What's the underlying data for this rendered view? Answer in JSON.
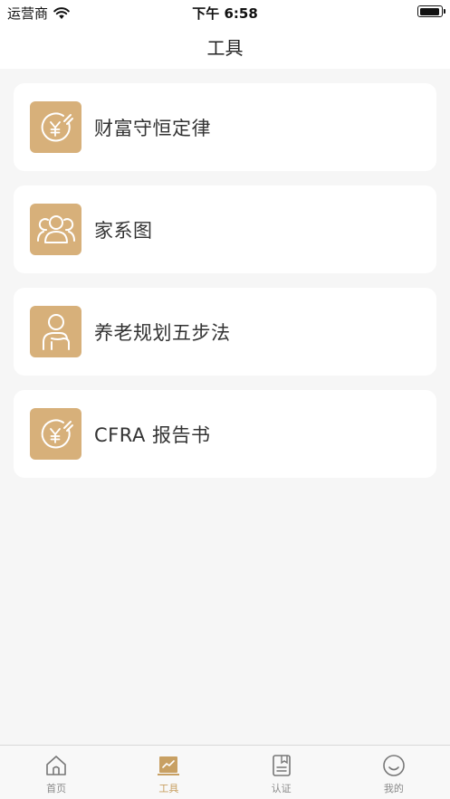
{
  "status_bar": {
    "carrier": "运营商",
    "time": "下午 6:58"
  },
  "nav": {
    "title": "工具"
  },
  "tools": [
    {
      "label": "财富守恒定律",
      "icon": "yen-coin-icon"
    },
    {
      "label": "家系图",
      "icon": "family-icon"
    },
    {
      "label": "养老规划五步法",
      "icon": "elderly-person-icon"
    },
    {
      "label": "CFRA 报告书",
      "icon": "yen-coin-icon"
    }
  ],
  "tab_bar": {
    "items": [
      {
        "label": "首页",
        "icon": "home-icon",
        "active": false
      },
      {
        "label": "工具",
        "icon": "chart-icon",
        "active": true
      },
      {
        "label": "认证",
        "icon": "document-icon",
        "active": false
      },
      {
        "label": "我的",
        "icon": "smile-icon",
        "active": false
      }
    ]
  },
  "colors": {
    "accent": "#d7b07a",
    "tab_active": "#c8a063",
    "tab_inactive": "#8a8a8a",
    "background": "#f6f6f6"
  }
}
